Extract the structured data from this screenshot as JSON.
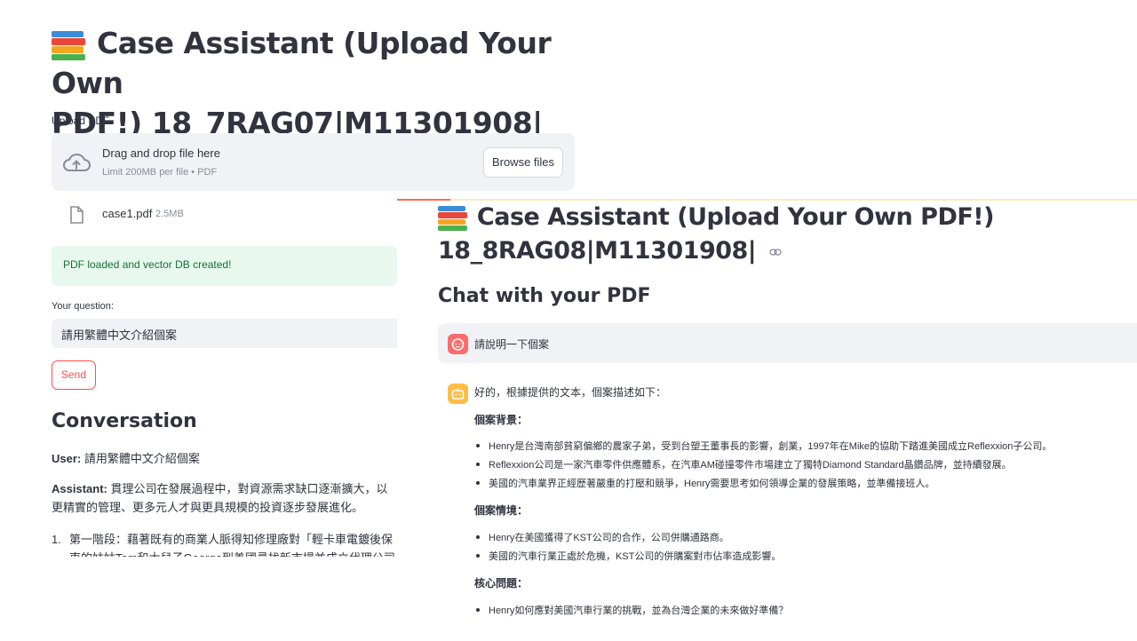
{
  "left": {
    "title": "Case Assistant (Upload Your Own PDF!) 18_7RAG07|M11301908|",
    "title_line1": "Case Assistant (Upload Your Own",
    "title_line2": "PDF!) 18_7RAG07|M11301908|",
    "upload_label": "Upload PDF",
    "dropzone": {
      "title": "Drag and drop file here",
      "limit": "Limit 200MB per file • PDF",
      "browse_label": "Browse files"
    },
    "file": {
      "name": "case1.pdf",
      "size": "2.5MB"
    },
    "success_message": "PDF loaded and vector DB created!",
    "question_label": "Your question:",
    "question_value": "請用繁體中文介紹個案",
    "send_label": "Send",
    "conversation_title": "Conversation",
    "user_prefix": "User:",
    "user_text": "請用繁體中文介紹個案",
    "assistant_prefix": "Assistant:",
    "assistant_text": "貫理公司在發展過程中，對資源需求缺口逐漸擴大，以更精實的管理、更多元人才與更具規模的投資逐步發展進化。",
    "list_item_1": "第一階段：藉著既有的商業人脈得知修理廠對「輕卡車電鍍後保",
    "list_item_1_cont": "東的姑姑Tom和大兒子George到美國尋找新市場並成立代理公司"
  },
  "right": {
    "title_line1": "Case Assistant (Upload Your Own PDF!)",
    "title_line2": "18_8RAG08|M11301908|",
    "chat_heading": "Chat with your PDF",
    "user_message": "請說明一下個案",
    "bot_intro": "好的，根據提供的文本，個案描述如下：",
    "sections": [
      {
        "heading": "個案背景：",
        "bullets": [
          "Henry是台灣南部貧窮偏鄉的農家子弟，受到台塑王董事長的影響，創業，1997年在Mike的協助下踏進美國成立Reflexxion子公司。",
          "Reflexxion公司是一家汽車零件供應體系，在汽車AM碰撞零件市場建立了獨特Diamond Standard晶鑽品牌，並持續發展。",
          "美國的汽車業界正經歷著嚴重的打壓和競爭，Henry需要思考如何領導企業的發展策略，並準備接班人。"
        ]
      },
      {
        "heading": "個案情境：",
        "bullets": [
          "Henry在美國獲得了KST公司的合作，公司併購通路商。",
          "美國的汽車行業正處於危機，KST公司的併購案對市佔率造成影響。"
        ]
      },
      {
        "heading": "核心問題：",
        "bullets": [
          "Henry如何應對美國汽車行業的挑戰，並為台灣企業的未來做好準備？"
        ]
      }
    ]
  },
  "colors": {
    "primary": "#ff4b4b",
    "text": "#31333f",
    "muted": "#8a8d97",
    "widget_bg": "#f0f2f6",
    "success_bg": "#e8f8ee",
    "success_text": "#177233",
    "user_avatar": "#ff6b6b",
    "bot_avatar": "#ffbd45"
  },
  "icons": [
    "books-icon",
    "cloud-upload-icon",
    "file-icon",
    "link-icon",
    "user-avatar-icon",
    "bot-avatar-icon"
  ]
}
